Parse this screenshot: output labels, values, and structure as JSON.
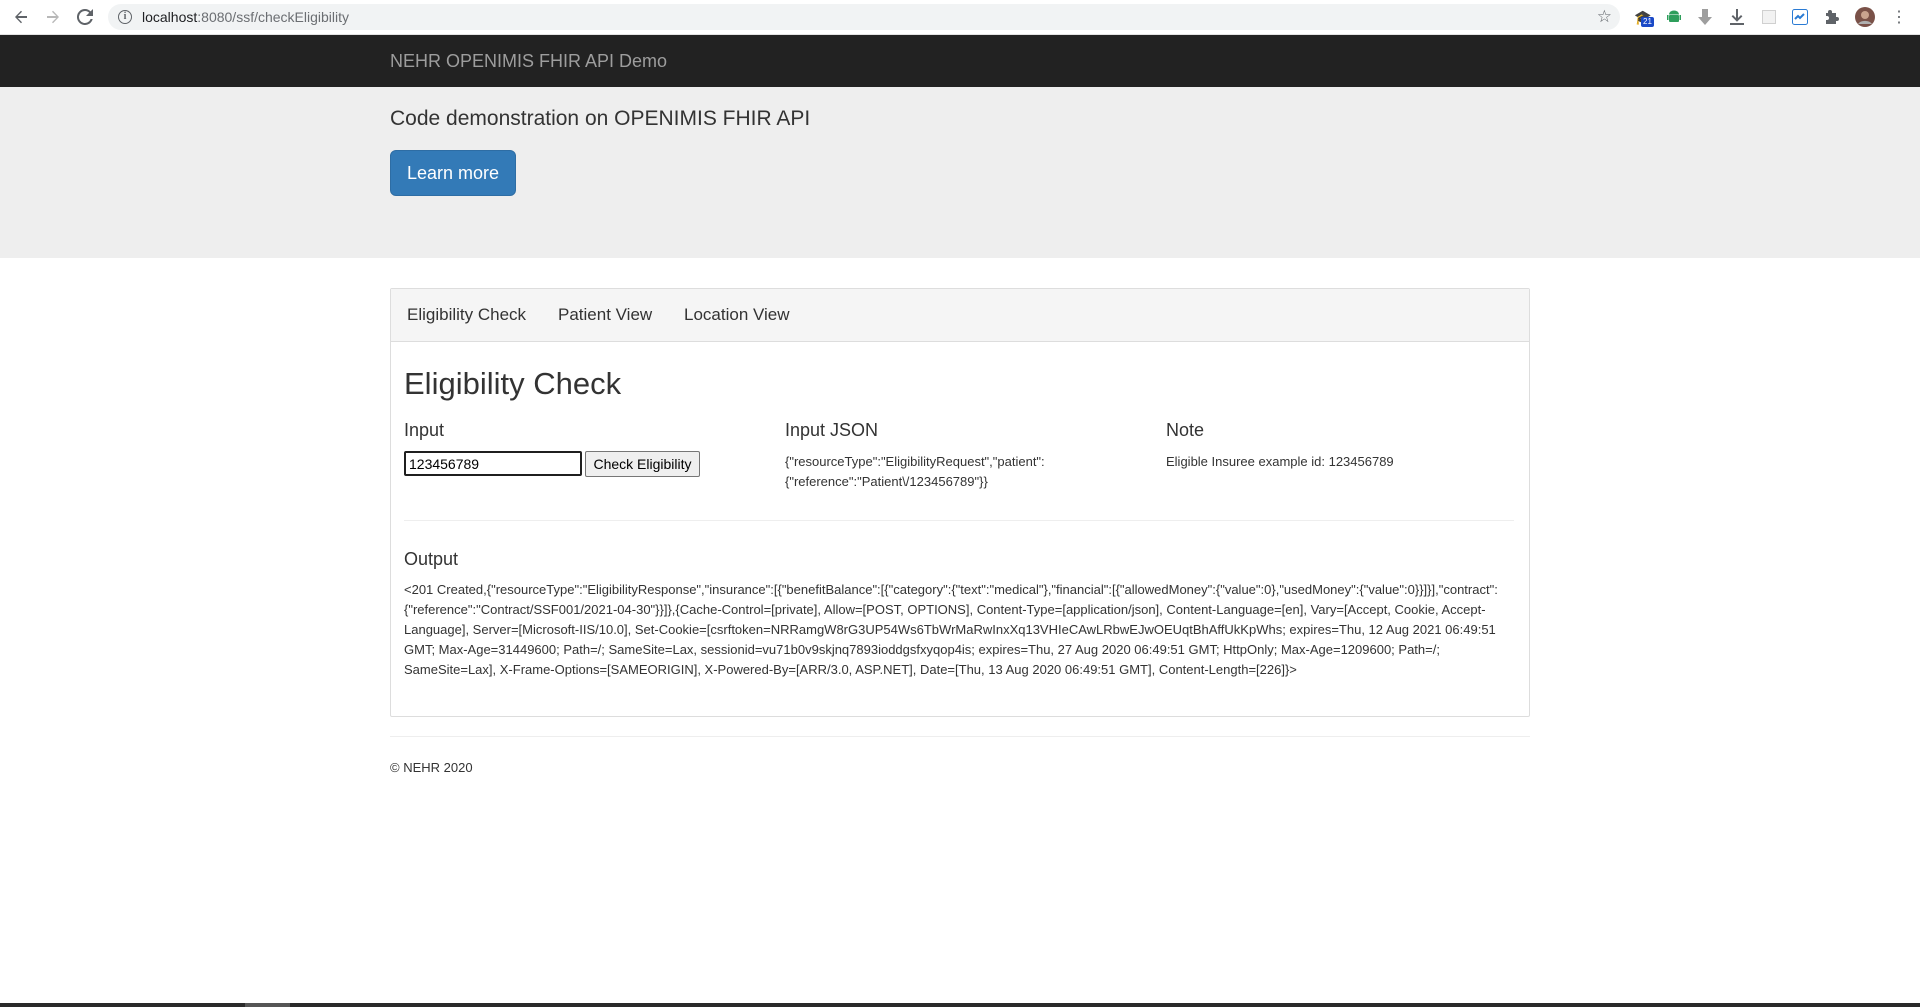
{
  "browser": {
    "url_host": "localhost",
    "url_path": ":8080/ssf/checkEligibility",
    "ext_badge": "21"
  },
  "navbar": {
    "brand": "NEHR OPENIMIS FHIR API Demo"
  },
  "jumbotron": {
    "lead": "Code demonstration on OPENIMIS FHIR API",
    "button_label": "Learn more"
  },
  "tabs": [
    {
      "label": "Eligibility Check"
    },
    {
      "label": "Patient View"
    },
    {
      "label": "Location View"
    }
  ],
  "main": {
    "title": "Eligibility Check",
    "input_label": "Input",
    "input_value": "123456789",
    "check_button": "Check Eligibility",
    "json_label": "Input JSON",
    "json_text": "{\"resourceType\":\"EligibilityRequest\",\"patient\":{\"reference\":\"Patient\\/123456789\"}}",
    "note_label": "Note",
    "note_text": "Eligible Insuree example id: 123456789",
    "output_label": "Output",
    "output_text": "<201 Created,{\"resourceType\":\"EligibilityResponse\",\"insurance\":[{\"benefitBalance\":[{\"category\":{\"text\":\"medical\"},\"financial\":[{\"allowedMoney\":{\"value\":0},\"usedMoney\":{\"value\":0}}]}],\"contract\":{\"reference\":\"Contract/SSF001/2021-04-30\"}}]},{Cache-Control=[private], Allow=[POST, OPTIONS], Content-Type=[application/json], Content-Language=[en], Vary=[Accept, Cookie, Accept-Language], Server=[Microsoft-IIS/10.0], Set-Cookie=[csrftoken=NRRamgW8rG3UP54Ws6TbWrMaRwInxXq13VHIeCAwLRbwEJwOEUqtBhAffUkKpWhs; expires=Thu, 12 Aug 2021 06:49:51 GMT; Max-Age=31449600; Path=/; SameSite=Lax, sessionid=vu71b0v9skjnq7893ioddgsfxyqop4is; expires=Thu, 27 Aug 2020 06:49:51 GMT; HttpOnly; Max-Age=1209600; Path=/; SameSite=Lax], X-Frame-Options=[SAMEORIGIN], X-Powered-By=[ARR/3.0, ASP.NET], Date=[Thu, 13 Aug 2020 06:49:51 GMT], Content-Length=[226]}>"
  },
  "footer": {
    "text": "© NEHR 2020"
  },
  "colors": {
    "navbar": "#222222",
    "jumbotron": "#eeeeee",
    "primary": "#337ab7"
  }
}
